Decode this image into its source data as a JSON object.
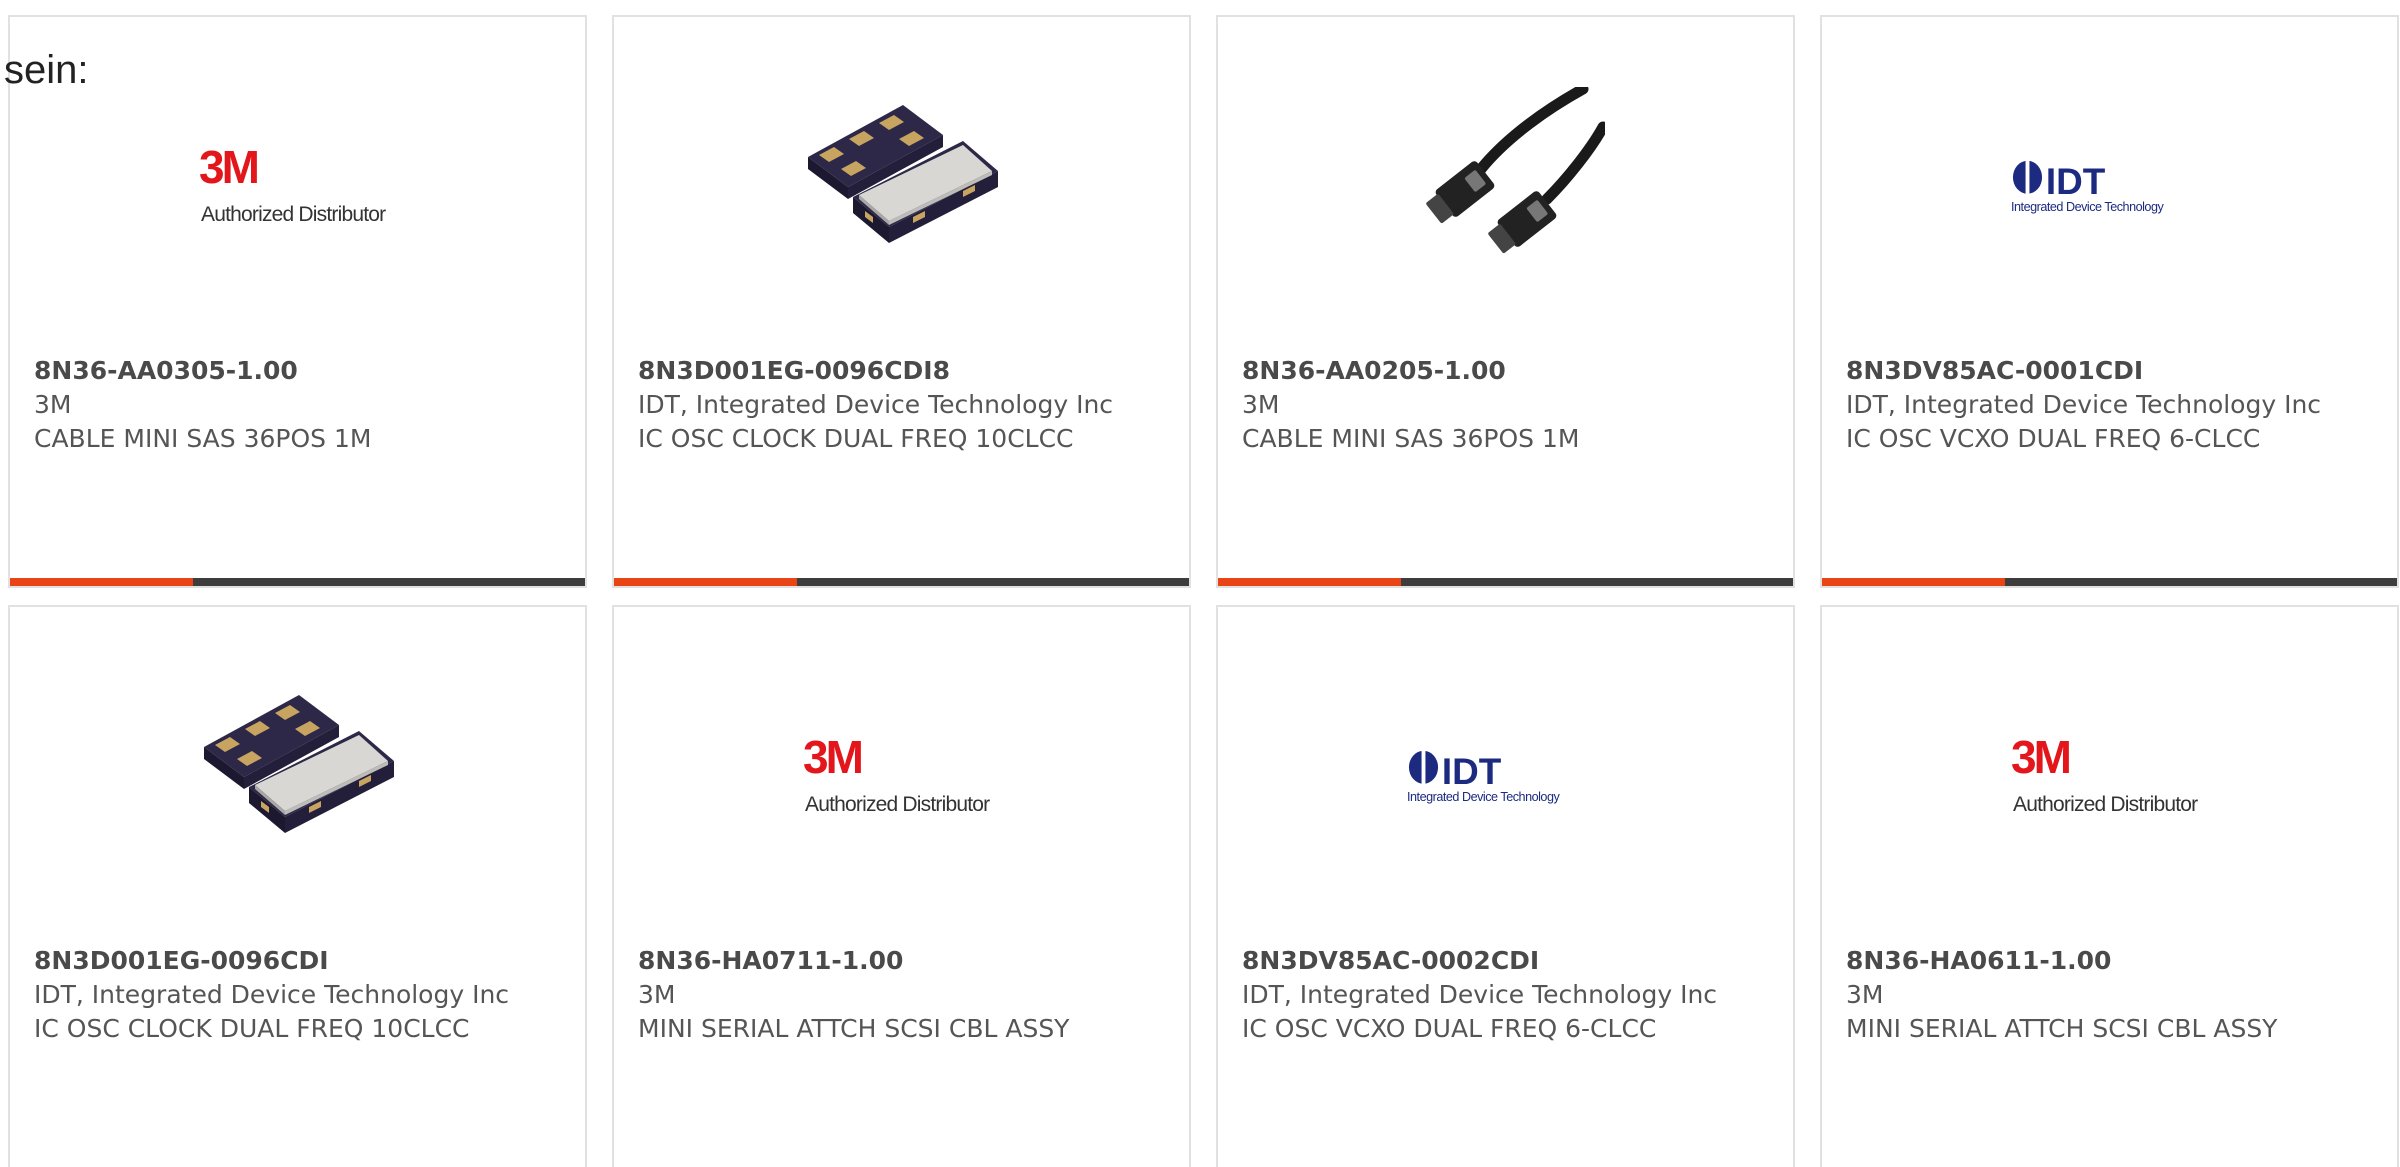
{
  "intro_text": "sein:",
  "colors": {
    "accent": "#e84415",
    "bar_dark": "#3d3d3d",
    "card_border": "#e1e1e1",
    "text": "#555555",
    "brand_3m_red": "#e3171b",
    "brand_idt_navy": "#1c2b80"
  },
  "products": [
    {
      "part_number": "8N36-AA0305-1.00",
      "manufacturer": "3M",
      "description": "CABLE MINI SAS 36POS 1M",
      "image": "3m-authorized-distributor-logo",
      "logo_text": {
        "brand": "3M",
        "tagline": "Authorized Distributor"
      }
    },
    {
      "part_number": "8N3D001EG-0096CDI8",
      "manufacturer": "IDT, Integrated Device Technology Inc",
      "description": "IC OSC CLOCK DUAL FREQ 10CLCC",
      "image": "oscillator-chip-photo"
    },
    {
      "part_number": "8N36-AA0205-1.00",
      "manufacturer": "3M",
      "description": "CABLE MINI SAS 36POS 1M",
      "image": "mini-sas-cable-photo"
    },
    {
      "part_number": "8N3DV85AC-0001CDI",
      "manufacturer": "IDT, Integrated Device Technology Inc",
      "description": "IC OSC VCXO DUAL FREQ 6-CLCC",
      "image": "idt-logo",
      "logo_text": {
        "brand": "IDT",
        "tagline": "Integrated Device Technology"
      }
    },
    {
      "part_number": "8N3D001EG-0096CDI",
      "manufacturer": "IDT, Integrated Device Technology Inc",
      "description": "IC OSC CLOCK DUAL FREQ 10CLCC",
      "image": "oscillator-chip-photo"
    },
    {
      "part_number": "8N36-HA0711-1.00",
      "manufacturer": "3M",
      "description": "MINI SERIAL ATTCH SCSI CBL ASSY",
      "image": "3m-authorized-distributor-logo",
      "logo_text": {
        "brand": "3M",
        "tagline": "Authorized Distributor"
      }
    },
    {
      "part_number": "8N3DV85AC-0002CDI",
      "manufacturer": "IDT, Integrated Device Technology Inc",
      "description": "IC OSC VCXO DUAL FREQ 6-CLCC",
      "image": "idt-logo",
      "logo_text": {
        "brand": "IDT",
        "tagline": "Integrated Device Technology"
      }
    },
    {
      "part_number": "8N36-HA0611-1.00",
      "manufacturer": "3M",
      "description": "MINI SERIAL ATTCH SCSI CBL ASSY",
      "image": "3m-authorized-distributor-logo",
      "logo_text": {
        "brand": "3M",
        "tagline": "Authorized Distributor"
      }
    }
  ]
}
